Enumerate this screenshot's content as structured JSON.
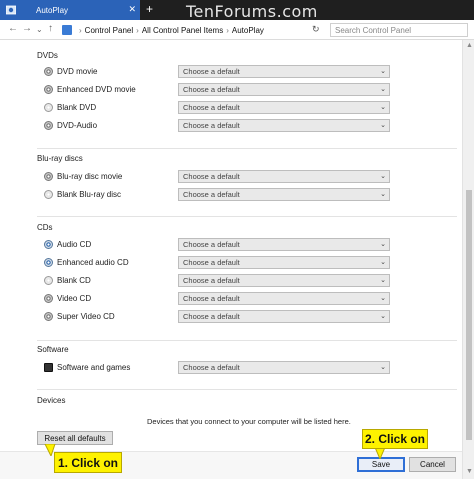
{
  "window": {
    "tab_title": "AutoPlay",
    "tab_close": "✕",
    "new_tab": "+",
    "watermark": "TenForums.com"
  },
  "address_bar": {
    "crumbs": [
      "Control Panel",
      "All Control Panel Items",
      "AutoPlay"
    ],
    "separator": "›",
    "search_placeholder": "Search Control Panel"
  },
  "sections": {
    "dvds": {
      "title": "DVDs",
      "items": [
        {
          "label": "DVD movie",
          "value": "Choose a default"
        },
        {
          "label": "Enhanced DVD movie",
          "value": "Choose a default"
        },
        {
          "label": "Blank DVD",
          "value": "Choose a default"
        },
        {
          "label": "DVD-Audio",
          "value": "Choose a default"
        }
      ]
    },
    "bluray": {
      "title": "Blu-ray discs",
      "items": [
        {
          "label": "Blu-ray disc movie",
          "value": "Choose a default"
        },
        {
          "label": "Blank Blu-ray disc",
          "value": "Choose a default"
        }
      ]
    },
    "cds": {
      "title": "CDs",
      "items": [
        {
          "label": "Audio CD",
          "value": "Choose a default"
        },
        {
          "label": "Enhanced audio CD",
          "value": "Choose a default"
        },
        {
          "label": "Blank CD",
          "value": "Choose a default"
        },
        {
          "label": "Video CD",
          "value": "Choose a default"
        },
        {
          "label": "Super Video CD",
          "value": "Choose a default"
        }
      ]
    },
    "software": {
      "title": "Software",
      "items": [
        {
          "label": "Software and games",
          "value": "Choose a default"
        }
      ]
    },
    "devices": {
      "title": "Devices",
      "text": "Devices that you connect to your computer will be listed here."
    }
  },
  "buttons": {
    "reset": "Reset all defaults",
    "save": "Save",
    "cancel": "Cancel"
  },
  "callouts": {
    "first": "1. Click on",
    "second": "2. Click on"
  },
  "colors": {
    "tab_accent": "#2b63b8",
    "callout": "#fef200",
    "focus_border": "#2f6fd6"
  }
}
